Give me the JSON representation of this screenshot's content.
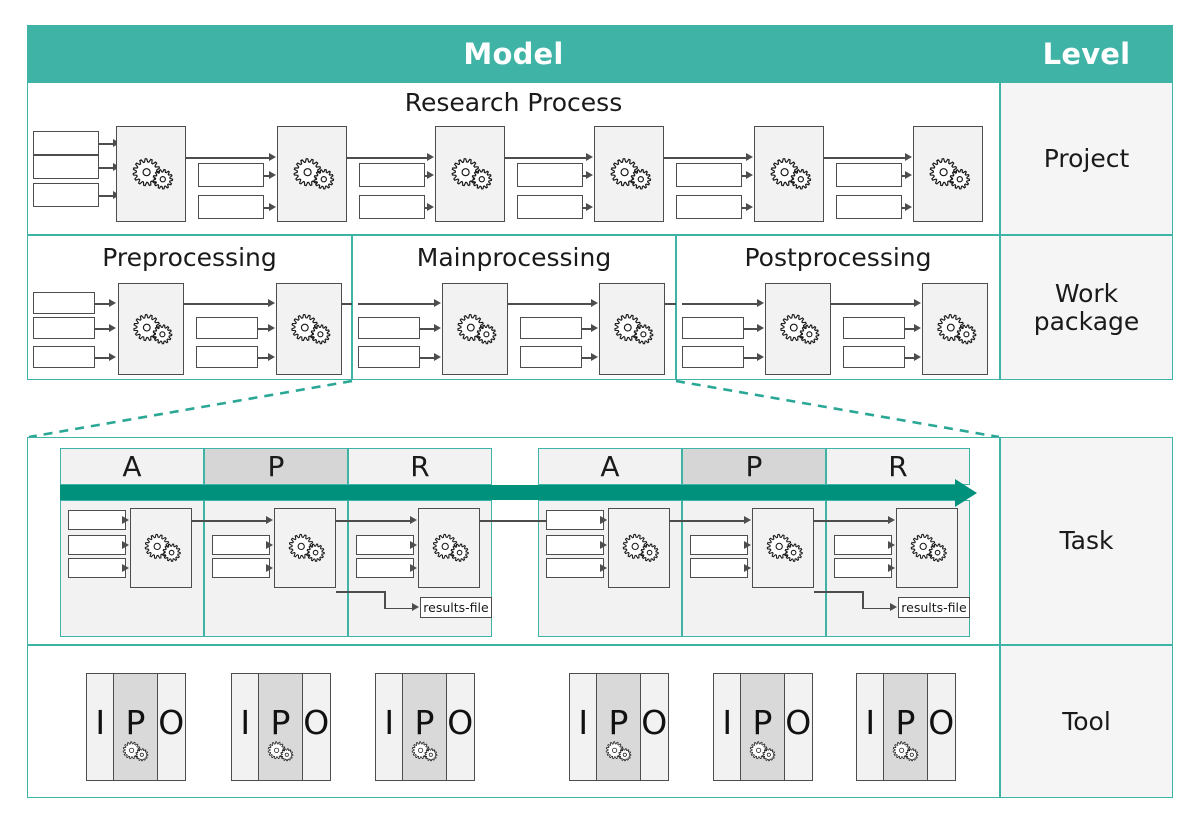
{
  "header": {
    "model_label": "Model",
    "level_label": "Level"
  },
  "colors": {
    "teal_header": "#3fb3a5",
    "teal_border": "#3fb3a5",
    "teal_arrow": "#00917c",
    "box_stroke": "#4d4d4d",
    "process_fill": "#f2f2f2",
    "level_fill": "#f5f5f5",
    "apr_dark_fill": "#d6d6d6"
  },
  "rows": [
    {
      "level": "Project",
      "title": "Research Process",
      "stage_count": 6,
      "icon": "gears-icon"
    },
    {
      "level": "Work\npackage",
      "sections": [
        {
          "title": "Preprocessing",
          "stage_count": 2
        },
        {
          "title": "Mainprocessing",
          "stage_count": 2
        },
        {
          "title": "Postprocessing",
          "stage_count": 2
        }
      ]
    },
    {
      "level": "Task",
      "groups": [
        {
          "phases": [
            "A",
            "P",
            "R"
          ],
          "artifact": "results-file"
        },
        {
          "phases": [
            "A",
            "P",
            "R"
          ],
          "artifact": "results-file"
        }
      ],
      "arrow": "time-arrow"
    },
    {
      "level": "Tool",
      "tool_count": 6,
      "segments": [
        "I",
        "P",
        "O"
      ],
      "icon": "gears-icon"
    }
  ],
  "level_labels": [
    "Project",
    "Work package",
    "Task",
    "Tool"
  ],
  "task_phase_labels": [
    "A",
    "P",
    "R",
    "A",
    "P",
    "R"
  ],
  "artifact_labels": [
    "results-file",
    "results-file"
  ],
  "tool_segment_labels": [
    "I",
    "P",
    "O"
  ]
}
